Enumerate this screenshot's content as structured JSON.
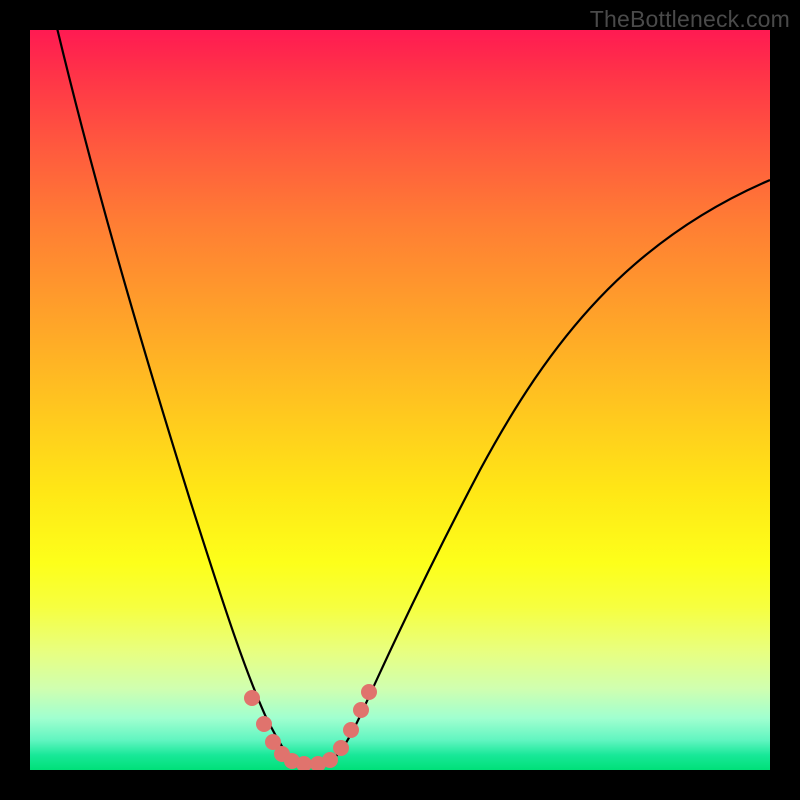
{
  "watermark": "TheBottleneck.com",
  "chart_data": {
    "type": "line",
    "title": "",
    "xlabel": "",
    "ylabel": "",
    "xlim": [
      0,
      100
    ],
    "ylim": [
      0,
      100
    ],
    "series": [
      {
        "name": "bottleneck-curve",
        "x": [
          0,
          5,
          10,
          15,
          20,
          24,
          28,
          30,
          32,
          34,
          36,
          38,
          40,
          43,
          46,
          50,
          55,
          60,
          66,
          72,
          80,
          88,
          96,
          100
        ],
        "y": [
          105,
          92,
          78,
          64,
          48,
          32,
          17,
          10,
          5,
          1,
          0,
          0,
          1,
          4,
          9,
          17,
          27,
          37,
          47,
          56,
          65,
          72,
          77,
          80
        ]
      },
      {
        "name": "markers",
        "x": [
          29,
          30,
          31,
          32,
          34,
          36,
          38,
          40,
          42,
          44,
          45
        ],
        "y": [
          8,
          6,
          4,
          2,
          1,
          1,
          1,
          2,
          4,
          7,
          9
        ]
      }
    ],
    "gradient_stops": [
      {
        "pos": 0,
        "color": "#ff1a52"
      },
      {
        "pos": 50,
        "color": "#ffc320"
      },
      {
        "pos": 78,
        "color": "#f6ff40"
      },
      {
        "pos": 100,
        "color": "#00e078"
      }
    ]
  }
}
